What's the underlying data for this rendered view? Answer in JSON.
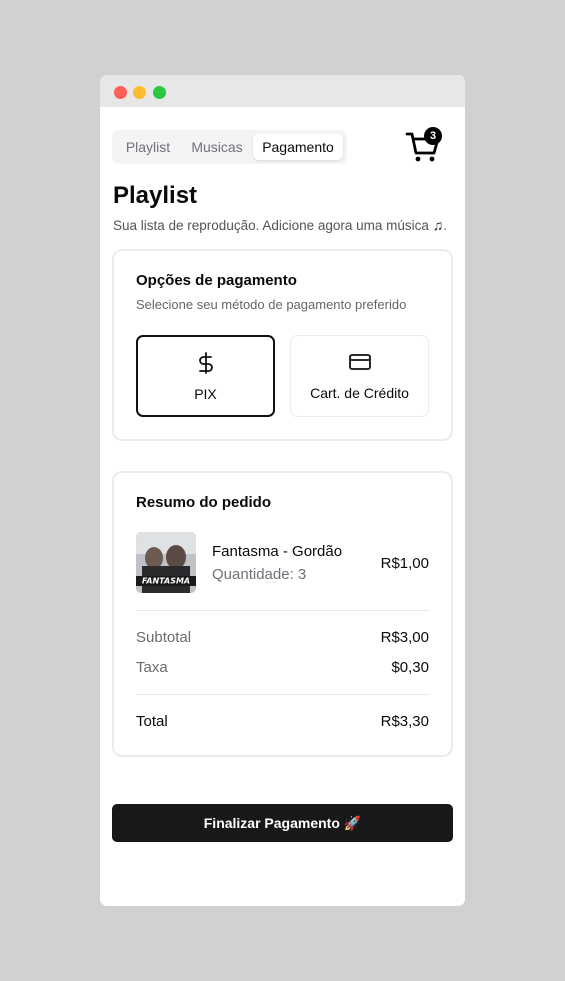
{
  "tabs": [
    {
      "label": "Playlist",
      "active": false
    },
    {
      "label": "Musicas",
      "active": false
    },
    {
      "label": "Pagamento",
      "active": true
    }
  ],
  "cart": {
    "count": "3",
    "icon": "cart-icon"
  },
  "header": {
    "title": "Playlist",
    "subtitle": "Sua lista de reprodução. Adicione agora uma música",
    "subtitle_icon": "♫",
    "subtitle_end": "."
  },
  "payment": {
    "title": "Opções de pagamento",
    "description": "Selecione seu método de pagamento preferido",
    "methods": [
      {
        "label": "PIX",
        "icon": "dollar-icon",
        "selected": true
      },
      {
        "label": "Cart. de Crédito",
        "icon": "credit-card-icon",
        "selected": false
      }
    ]
  },
  "summary": {
    "title": "Resumo do pedido",
    "item": {
      "name": "Fantasma - Gordão",
      "quantity": "Quantidade: 3",
      "price": "R$1,00",
      "cover_text": "FANTASMA"
    },
    "subtotal_label": "Subtotal",
    "subtotal_value": "R$3,00",
    "tax_label": "Taxa",
    "tax_value": "$0,30",
    "total_label": "Total",
    "total_value": "R$3,30"
  },
  "checkout": {
    "label": "Finalizar Pagamento",
    "emoji": "🚀"
  },
  "colors": {
    "primary": "#18181b",
    "background": "#d1d1d1",
    "muted": "#71717a"
  }
}
